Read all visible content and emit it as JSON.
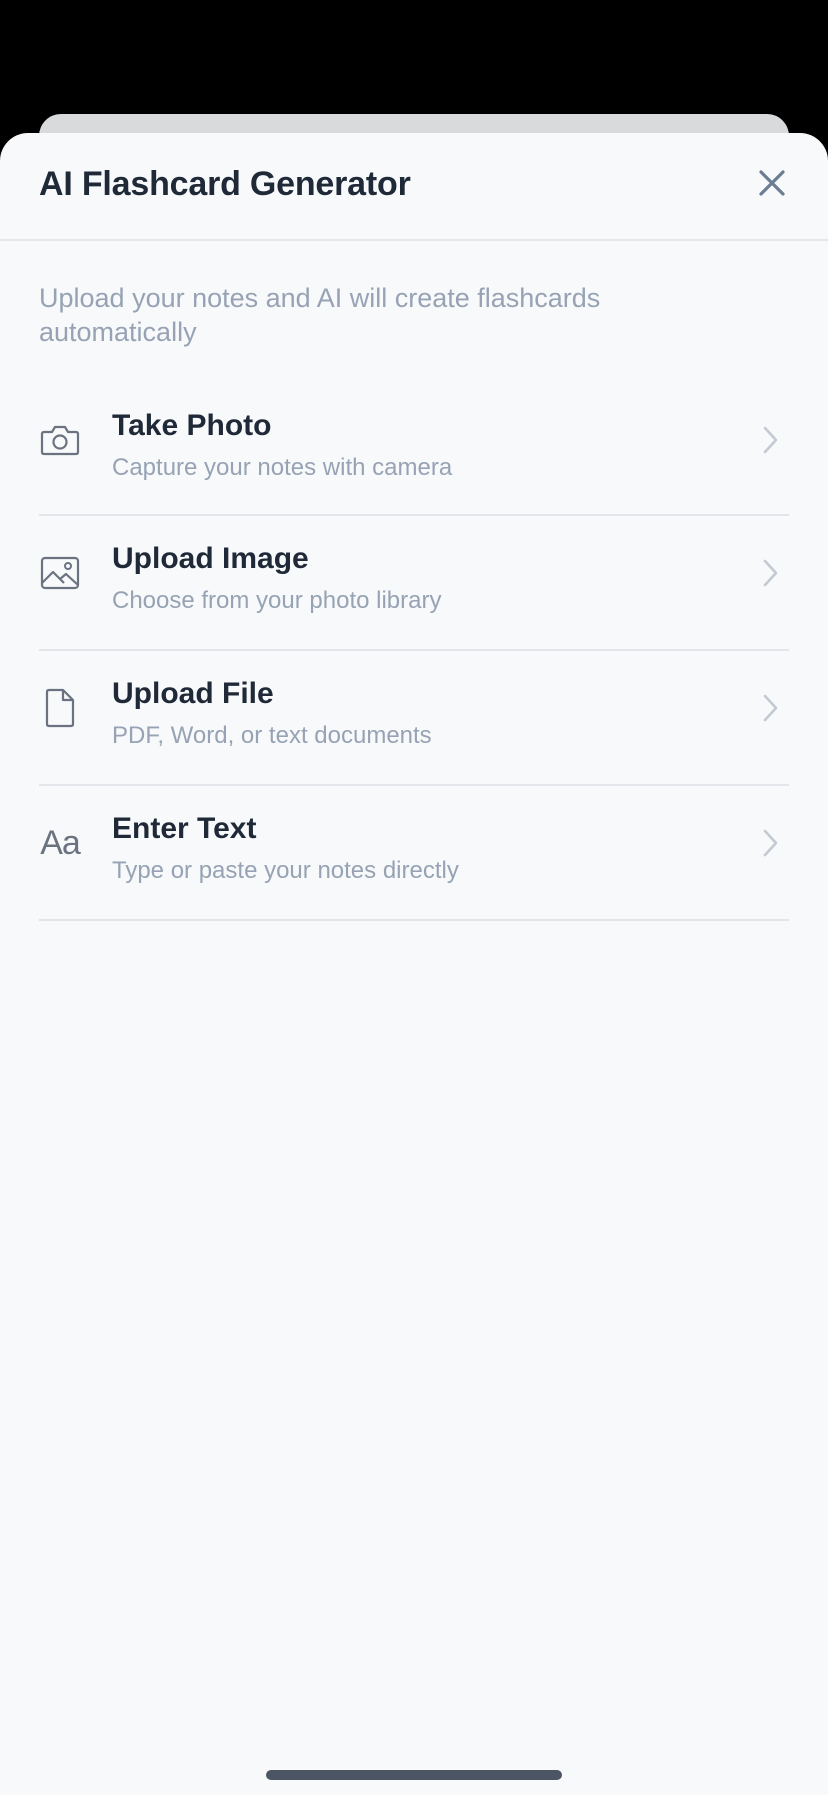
{
  "sheet": {
    "title": "AI Flashcard Generator",
    "subtitle": "Upload your notes and AI will create flashcards automatically"
  },
  "options": [
    {
      "title": "Take Photo",
      "description": "Capture your notes with camera",
      "icon": "camera-icon"
    },
    {
      "title": "Upload Image",
      "description": "Choose from your photo library",
      "icon": "image-icon"
    },
    {
      "title": "Upload File",
      "description": "PDF, Word, or text documents",
      "icon": "file-icon"
    },
    {
      "title": "Enter Text",
      "description": "Type or paste your notes directly",
      "icon": "text-icon",
      "glyph": "Aa"
    }
  ],
  "colors": {
    "text_primary": "#1f2937",
    "text_secondary": "#97a3b4",
    "sheet_background": "#f7f9fb",
    "divider": "#e2e5e9"
  }
}
